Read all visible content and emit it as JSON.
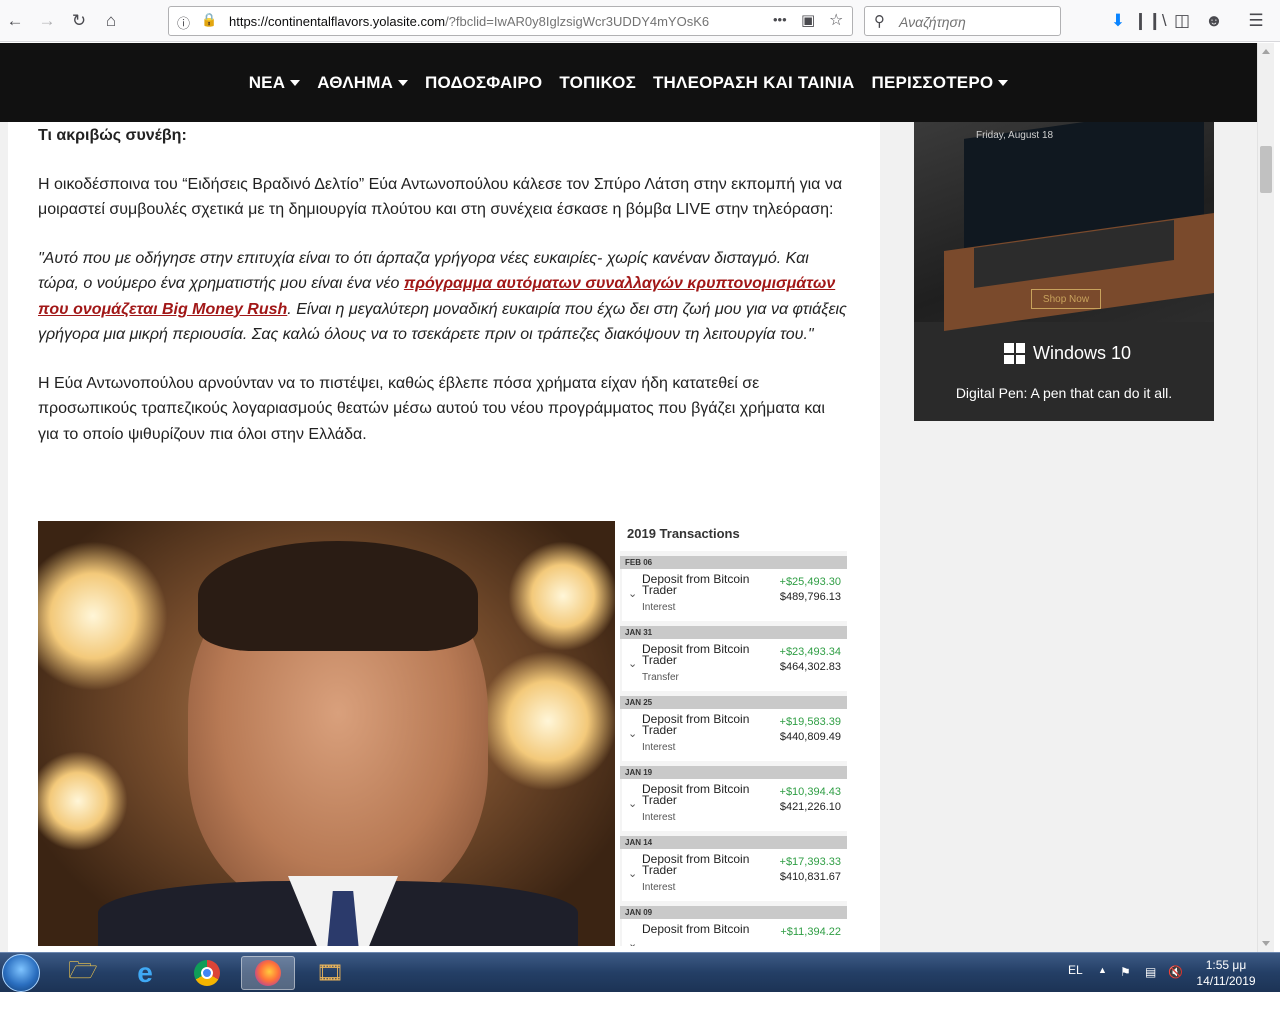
{
  "browser": {
    "url_host": "https://continentalflavors.yolasite.com",
    "url_rest": "/?fbclid=IwAR0y8IglzsigWcr3UDDY4mYOsK6",
    "search_placeholder": "Αναζήτηση",
    "menu_dots": "•••"
  },
  "nav": {
    "items": [
      {
        "label": "ΝΕΑ",
        "dropdown": true
      },
      {
        "label": "ΑΘΛΗΜΑ",
        "dropdown": true
      },
      {
        "label": "ΠΟΔΟΣΦΑΙΡΟ",
        "dropdown": false
      },
      {
        "label": "ΤΟΠΙΚΟΣ",
        "dropdown": false
      },
      {
        "label": "ΤΗΛΕΟΡΑΣΗ ΚΑΙ ΤΑΙΝΙΑ",
        "dropdown": false
      },
      {
        "label": "ΠΕΡΙΣΣΟΤΕΡΟ",
        "dropdown": true
      }
    ]
  },
  "article": {
    "heading": "Τι ακριβώς συνέβη:",
    "p1": "Η οικοδέσποινα του “Ειδήσεις Βραδινό Δελτίο” Εύα Αντωνοπούλου κάλεσε τον Σπύρο Λάτση στην εκπομπή για να μοιραστεί συμβουλές σχετικά με τη δημιουργία πλούτου και στη συνέχεια έσκασε η βόμβα LIVE στην τηλεόραση:",
    "quote_before": "\"Αυτό που με οδήγησε στην επιτυχία είναι το ότι άρπαζα γρήγορα νέες ευκαιρίες- χωρίς κανέναν δισταγμό. Και τώρα, ο νούμερο ένα χρηματιστής μου είναι ένα νέο ",
    "quote_link": "πρόγραμμα αυτόματων συναλλαγών κρυπτονομισμάτων που ονομάζεται Big Money Rush",
    "quote_after": ". Είναι η μεγαλύτερη μοναδική ευκαιρία που έχω δει στη ζωή μου για να φτιάξεις γρήγορα μια μικρή περιουσία. Σας καλώ όλους να το τσεκάρετε πριν οι τράπεζες διακόψουν τη λειτουργία του.\"",
    "p3": "Η Εύα Αντωνοπούλου αρνούνταν να το πιστέψει, καθώς έβλεπε πόσα χρήματα είχαν ήδη κατατεθεί σε προσωπικούς τραπεζικούς λογαριασμούς θεατών μέσω αυτού του νέου προγράμματος που βγάζει χρήματα και για το οποίο ψιθυρίζουν πια όλοι στην Ελλάδα."
  },
  "ad": {
    "screen_text": "Friday, August 18",
    "shop_now": "Shop Now",
    "brand": "Windows 10",
    "tagline": "Digital Pen: A pen that can do it all."
  },
  "transactions": {
    "title": "2019 Transactions",
    "rows": [
      {
        "date": "FEB 06",
        "line1": "Deposit from Bitcoin",
        "line2": "Trader",
        "type": "Interest",
        "amount": "+$25,493.30",
        "balance": "$489,796.13"
      },
      {
        "date": "JAN 31",
        "line1": "Deposit from Bitcoin",
        "line2": "Trader",
        "type": "Transfer",
        "amount": "+$23,493.34",
        "balance": "$464,302.83"
      },
      {
        "date": "JAN 25",
        "line1": "Deposit from Bitcoin",
        "line2": "Trader",
        "type": "Interest",
        "amount": "+$19,583.39",
        "balance": "$440,809.49"
      },
      {
        "date": "JAN 19",
        "line1": "Deposit from Bitcoin",
        "line2": "Trader",
        "type": "Interest",
        "amount": "+$10,394.43",
        "balance": "$421,226.10"
      },
      {
        "date": "JAN 14",
        "line1": "Deposit from Bitcoin",
        "line2": "Trader",
        "type": "Interest",
        "amount": "+$17,393.33",
        "balance": "$410,831.67"
      },
      {
        "date": "JAN 09",
        "line1": "Deposit from Bitcoin",
        "line2": "",
        "type": "",
        "amount": "+$11,394.22",
        "balance": ""
      }
    ]
  },
  "taskbar": {
    "lang": "EL",
    "time": "1:55 μμ",
    "date": "14/11/2019"
  }
}
